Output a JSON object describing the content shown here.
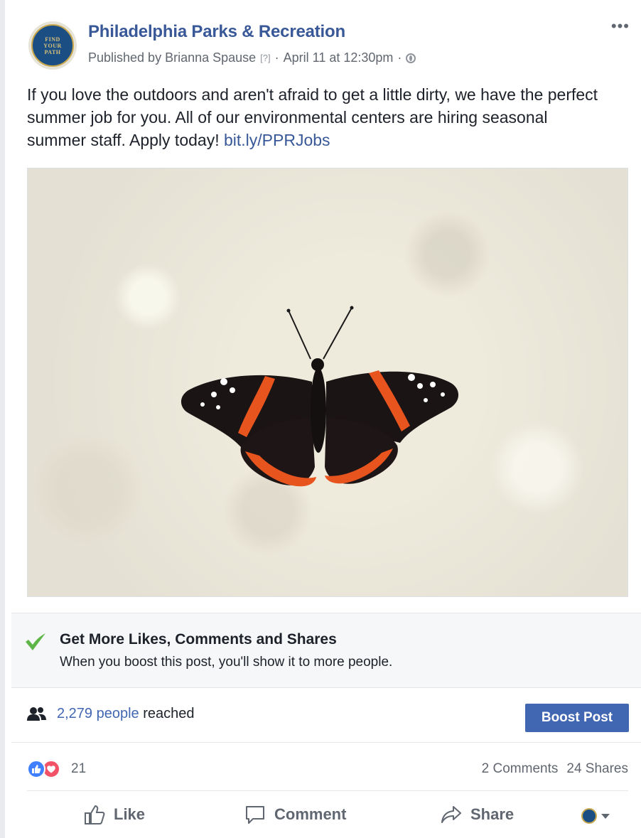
{
  "post": {
    "page_name": "Philadelphia Parks & Recreation",
    "avatar_text": [
      "FIND",
      "YOUR",
      "PATH"
    ],
    "published_by": "Published by Brianna Spause",
    "help_mark": "[?]",
    "separator": "·",
    "timestamp": "April 11 at 12:30pm",
    "body_text": "If you love the outdoors and aren't afraid to get a little dirty, we have the perfect summer job for you. All of our environmental centers are hiring seasonal summer staff. Apply today!",
    "link_text": "bit.ly/PPRJobs",
    "more_label": "•••"
  },
  "boost": {
    "title": "Get More Likes, Comments and Shares",
    "subtitle": "When you boost this post, you'll show it to more people."
  },
  "reach": {
    "count_text": "2,279 people",
    "suffix": "reached",
    "button_label": "Boost Post"
  },
  "engagement": {
    "reaction_count": "21",
    "comments": "2 Comments",
    "shares": "24 Shares"
  },
  "actions": {
    "like": "Like",
    "comment": "Comment",
    "share": "Share"
  },
  "colors": {
    "link_blue": "#385898",
    "button_blue": "#4267b2",
    "like_blue": "#4080ff",
    "love_red": "#f25268",
    "check_green": "#5fb648"
  }
}
